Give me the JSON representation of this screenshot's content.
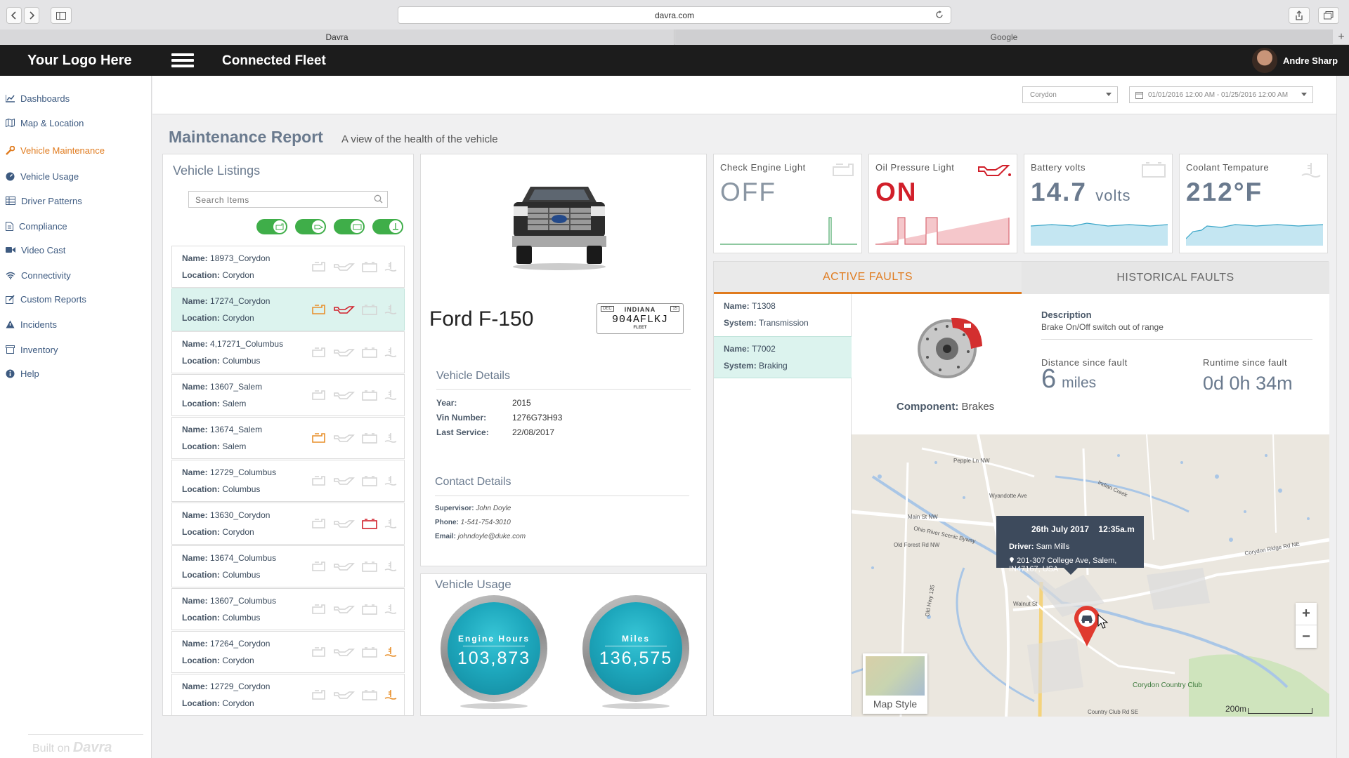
{
  "browser": {
    "url": "davra.com",
    "tabs": [
      "Davra",
      "Google"
    ],
    "newtab": "+"
  },
  "app": {
    "logo": "Your Logo Here",
    "title": "Connected Fleet",
    "user": "Andre Sharp"
  },
  "sidebar": {
    "items": [
      {
        "label": "Dashboards",
        "icon": "chart-icon"
      },
      {
        "label": "Map & Location",
        "icon": "map-icon"
      },
      {
        "label": "Vehicle Maintenance",
        "icon": "wrench-icon",
        "active": true
      },
      {
        "label": "Vehicle Usage",
        "icon": "gauge-icon"
      },
      {
        "label": "Driver Patterns",
        "icon": "grid-icon"
      },
      {
        "label": "Compliance",
        "icon": "document-icon"
      },
      {
        "label": "Video Cast",
        "icon": "video-icon"
      },
      {
        "label": "Connectivity",
        "icon": "wifi-icon"
      },
      {
        "label": "Custom Reports",
        "icon": "edit-icon"
      },
      {
        "label": "Incidents",
        "icon": "warning-icon"
      },
      {
        "label": "Inventory",
        "icon": "box-icon"
      },
      {
        "label": "Help",
        "icon": "info-icon"
      }
    ],
    "built_on": "Built on",
    "built_brand": "Davra"
  },
  "filters": {
    "location": "Corydon",
    "daterange": "01/01/2016 12:00 AM - 01/25/2016 12:00 AM"
  },
  "page": {
    "title": "Maintenance Report",
    "subtitle": "A view of the health of the vehicle"
  },
  "listings": {
    "title": "Vehicle Listings",
    "search_placeholder": "Search Items",
    "name_label": "Name:",
    "location_label": "Location:",
    "rows": [
      {
        "name": "18973_Corydon",
        "location": "Corydon",
        "engine": "off",
        "oil": "off",
        "battery": "off",
        "coolant": "off"
      },
      {
        "name": "17274_Corydon",
        "location": "Corydon",
        "engine": "warn",
        "oil": "alert",
        "battery": "off",
        "coolant": "off",
        "selected": true
      },
      {
        "name": "4,17271_Columbus",
        "location": "Columbus",
        "engine": "off",
        "oil": "off",
        "battery": "off",
        "coolant": "off"
      },
      {
        "name": "13607_Salem",
        "location": "Salem",
        "engine": "off",
        "oil": "off",
        "battery": "off",
        "coolant": "off"
      },
      {
        "name": "13674_Salem",
        "location": "Salem",
        "engine": "warn",
        "oil": "off",
        "battery": "off",
        "coolant": "off"
      },
      {
        "name": "12729_Columbus",
        "location": "Columbus",
        "engine": "off",
        "oil": "off",
        "battery": "off",
        "coolant": "off"
      },
      {
        "name": "13630_Corydon",
        "location": "Corydon",
        "engine": "off",
        "oil": "off",
        "battery": "alert",
        "coolant": "off"
      },
      {
        "name": "13674_Columbus",
        "location": "Columbus",
        "engine": "off",
        "oil": "off",
        "battery": "off",
        "coolant": "off"
      },
      {
        "name": "13607_Columbus",
        "location": "Columbus",
        "engine": "off",
        "oil": "off",
        "battery": "off",
        "coolant": "off"
      },
      {
        "name": "17264_Corydon",
        "location": "Corydon",
        "engine": "off",
        "oil": "off",
        "battery": "off",
        "coolant": "warn"
      },
      {
        "name": "12729_Corydon",
        "location": "Corydon",
        "engine": "off",
        "oil": "off",
        "battery": "off",
        "coolant": "warn"
      }
    ]
  },
  "vehicle": {
    "name": "Ford F-150",
    "plate": {
      "state": "INDIANA",
      "number": "904AFLKJ",
      "type": "FLEET",
      "month": "DEC",
      "year": "15"
    },
    "details_title": "Vehicle Details",
    "year_label": "Year:",
    "year": "2015",
    "vin_label": "Vin Number:",
    "vin": "1276G73H93",
    "service_label": "Last Service:",
    "service": "22/08/2017",
    "contact_title": "Contact Details",
    "supervisor_label": "Supervisor:",
    "supervisor": "John Doyle",
    "phone_label": "Phone:",
    "phone": "1-541-754-3010",
    "email_label": "Email:",
    "email": "johndoyle@duke.com"
  },
  "usage": {
    "title": "Vehicle Usage",
    "engine_label": "Engine Hours",
    "engine_value": "103,873",
    "miles_label": "Miles",
    "miles_value": "136,575"
  },
  "cards": {
    "engine": {
      "title": "Check Engine Light",
      "value": "OFF"
    },
    "oil": {
      "title": "Oil Pressure Light",
      "value": "ON"
    },
    "battery": {
      "title": "Battery volts",
      "value": "14.7",
      "unit": "volts"
    },
    "coolant": {
      "title": "Coolant Tempature",
      "value": "212°F"
    }
  },
  "colors": {
    "accent": "#e07b1e",
    "alert": "#d11f2a",
    "ok": "#3fae49",
    "teal": "#1ea8bd",
    "value_gray": "#6a7a8e"
  },
  "faults": {
    "tab_active": "ACTIVE FAULTS",
    "tab_history": "HISTORICAL FAULTS",
    "name_label": "Name:",
    "system_label": "System:",
    "items": [
      {
        "name": "T1308",
        "system": "Transmission"
      },
      {
        "name": "T7002",
        "system": "Braking",
        "selected": true
      }
    ],
    "component_label": "Component:",
    "component": "Brakes",
    "desc_title": "Description",
    "desc": "Brake On/Off switch out of range",
    "distance_label": "Distance since fault",
    "distance_value": "6",
    "distance_unit": "miles",
    "runtime_label": "Runtime since fault",
    "runtime_value": "0d 0h 34m"
  },
  "map": {
    "popup_date": "26th July 2017",
    "popup_time": "12:35a.m",
    "driver_label": "Driver:",
    "driver": "Sam Mills",
    "address": "201-307 College Ave, Salem, IN47167, USA",
    "style_label": "Map Style",
    "scale": "200m",
    "zoom_in": "+",
    "zoom_out": "−",
    "labels": [
      "Ohio River Scenic Byway",
      "Indian Creek",
      "Corydon Country Club",
      "Main St NW",
      "Old Forest Rd NW",
      "Walnut St",
      "Corydon Ridge Rd NE",
      "Wyandotte Ave",
      "Pepple Ln NW",
      "Country Club Rd SE",
      "Old Hwy 135"
    ]
  }
}
